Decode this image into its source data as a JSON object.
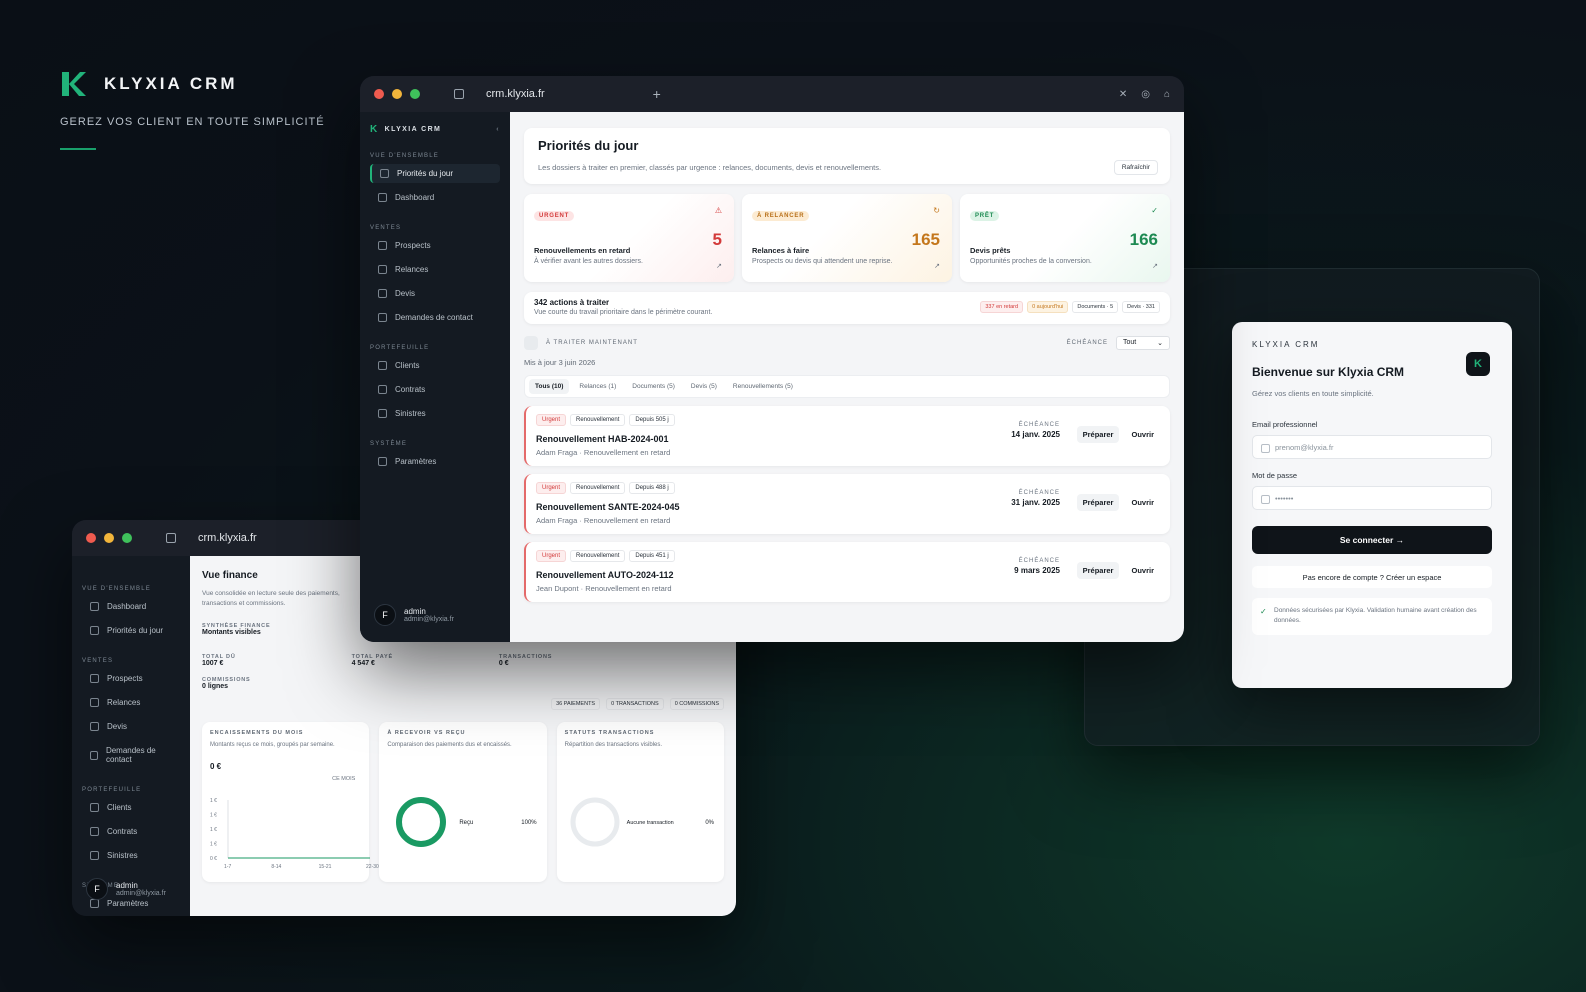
{
  "brand": {
    "name": "KLYXIA CRM",
    "tagline": "GEREZ VOS CLIENT EN TOUTE SIMPLICITÉ"
  },
  "main": {
    "url": "crm.klyxia.fr",
    "sidebar": {
      "brand": "KLYXIA CRM",
      "sections": [
        {
          "title": "VUE D'ENSEMBLE",
          "items": [
            "Priorités du jour",
            "Dashboard"
          ]
        },
        {
          "title": "VENTES",
          "items": [
            "Prospects",
            "Relances",
            "Devis",
            "Demandes de contact"
          ]
        },
        {
          "title": "PORTEFEUILLE",
          "items": [
            "Clients",
            "Contrats",
            "Sinistres"
          ]
        },
        {
          "title": "SYSTÈME",
          "items": [
            "Paramètres"
          ]
        }
      ],
      "user": {
        "initial": "F",
        "name": "admin",
        "email": "admin@klyxia.fr"
      }
    },
    "header": {
      "title": "Priorités du jour",
      "subtitle": "Les dossiers à traiter en premier, classés par urgence : relances, documents, devis et renouvellements.",
      "refresh": "Rafraîchir"
    },
    "stats": [
      {
        "badge": "URGENT",
        "value": "5",
        "title": "Renouvellements en retard",
        "desc": "À vérifier avant les autres dossiers.",
        "icon": "warning-icon"
      },
      {
        "badge": "À RELANCER",
        "value": "165",
        "title": "Relances à faire",
        "desc": "Prospects ou devis qui attendent une reprise.",
        "icon": "refresh-icon"
      },
      {
        "badge": "PRÊT",
        "value": "166",
        "title": "Devis prêts",
        "desc": "Opportunités proches de la conversion.",
        "icon": "check-icon"
      }
    ],
    "actions": {
      "title": "342 actions à traiter",
      "desc": "Vue courte du travail prioritaire dans le périmètre courant.",
      "chips": [
        "337 en retard",
        "0 aujourd'hui",
        "Documents · 5",
        "Devis · 331"
      ]
    },
    "filter": {
      "label": "À TRAITER MAINTENANT",
      "echeance": "ÉCHÉANCE",
      "select": "Tout",
      "updated": "Mis à jour 3 juin 2026"
    },
    "tabs": [
      "Tous (10)",
      "Relances (1)",
      "Documents (5)",
      "Devis (5)",
      "Renouvellements (5)"
    ],
    "rows": [
      {
        "tags": [
          "Urgent",
          "Renouvellement",
          "Depuis 505 j"
        ],
        "title": "Renouvellement HAB-2024-001",
        "sub": "Adam Fraga · Renouvellement en retard",
        "due_label": "ÉCHÉANCE",
        "due": "14 janv. 2025"
      },
      {
        "tags": [
          "Urgent",
          "Renouvellement",
          "Depuis 488 j"
        ],
        "title": "Renouvellement SANTE-2024-045",
        "sub": "Adam Fraga · Renouvellement en retard",
        "due_label": "ÉCHÉANCE",
        "due": "31 janv. 2025"
      },
      {
        "tags": [
          "Urgent",
          "Renouvellement",
          "Depuis 451 j"
        ],
        "title": "Renouvellement AUTO-2024-112",
        "sub": "Jean Dupont · Renouvellement en retard",
        "due_label": "ÉCHÉANCE",
        "due": "9 mars 2025"
      }
    ],
    "btn_prepare": "Préparer",
    "btn_open": "Ouvrir"
  },
  "finance": {
    "url": "crm.klyxia.fr",
    "sidebar": {
      "sections": [
        {
          "title": "VUE D'ENSEMBLE",
          "items": [
            "Dashboard",
            "Priorités du jour"
          ]
        },
        {
          "title": "VENTES",
          "items": [
            "Prospects",
            "Relances",
            "Devis",
            "Demandes de contact"
          ]
        },
        {
          "title": "PORTEFEUILLE",
          "items": [
            "Clients",
            "Contrats",
            "Sinistres"
          ]
        },
        {
          "title": "SYSTÈME",
          "items": [
            "Paramètres"
          ]
        }
      ],
      "user": {
        "initial": "F",
        "name": "admin",
        "email": "admin@klyxia.fr"
      }
    },
    "title": "Vue finance",
    "subtitle": "Vue consolidée en lecture seule des paiements, transactions et commissions.",
    "synth_title": "SYNTHÈSE FINANCE",
    "synth_sub": "Montants visibles",
    "metrics": [
      {
        "label": "TOTAL DÛ",
        "value": "1007 €"
      },
      {
        "label": "TOTAL PAYÉ",
        "value": "4 547 €"
      },
      {
        "label": "TRANSACTIONS",
        "value": "0 €"
      },
      {
        "label": "COMMISSIONS",
        "value": "0 lignes"
      }
    ],
    "counts": [
      "36 PAIEMENTS",
      "0 TRANSACTIONS",
      "0 COMMISSIONS"
    ],
    "panels": [
      {
        "title": "ENCAISSEMENTS DU MOIS",
        "desc": "Montants reçus ce mois, groupés par semaine.",
        "value": "0 €",
        "tag": "CE MOIS"
      },
      {
        "title": "À RECEVOIR VS REÇU",
        "desc": "Comparaison des paiements dus et encaissés.",
        "legend": "Reçu",
        "pct": "100%"
      },
      {
        "title": "STATUTS TRANSACTIONS",
        "desc": "Répartition des transactions visibles.",
        "legend": "Aucune transaction",
        "pct": "0%"
      }
    ],
    "chart_data": {
      "type": "line",
      "categories": [
        "1-7",
        "8-14",
        "15-21",
        "22-30"
      ],
      "values": [
        0,
        0,
        0,
        0
      ],
      "yticks": [
        "1 €",
        "1 €",
        "1 €",
        "1 €",
        "0 €"
      ]
    }
  },
  "login": {
    "brand": "KLYXIA CRM",
    "title": "Bienvenue sur Klyxia CRM",
    "subtitle": "Gérez vos clients en toute simplicité.",
    "email_label": "Email professionnel",
    "email_placeholder": "prenom@klyxia.fr",
    "password_label": "Mot de passe",
    "password_value": "•••••••",
    "submit": "Se connecter →",
    "signup": "Pas encore de compte ? Créer un espace",
    "note": "Données sécurisées par Klyxia. Validation humaine avant création des données."
  }
}
